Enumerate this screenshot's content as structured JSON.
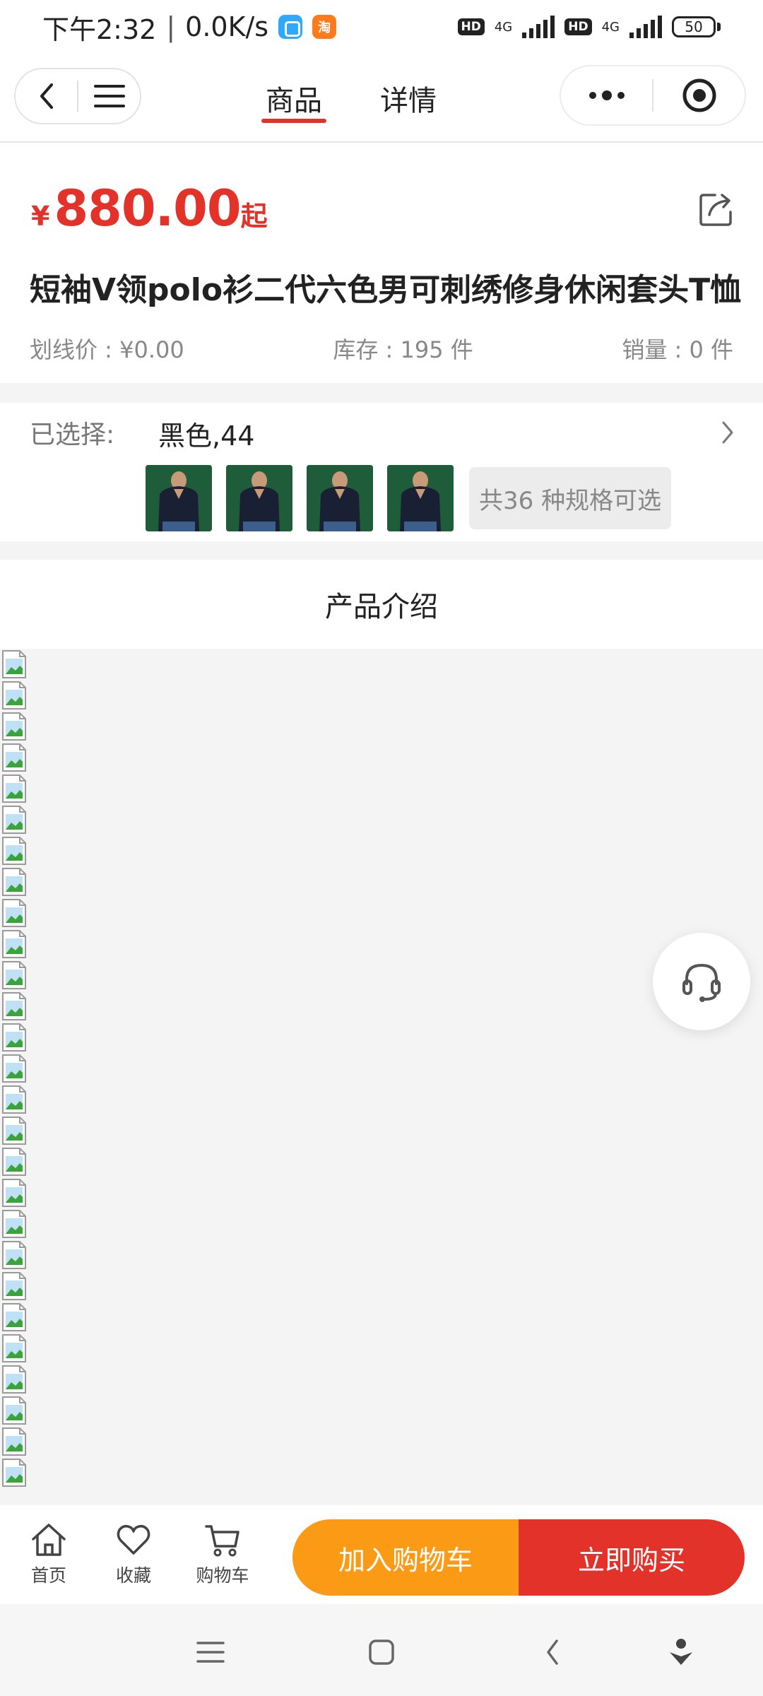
{
  "status_bar": {
    "time": "下午2:32",
    "speed": "0.0K/s",
    "app2_text": "淘",
    "hd1": "HD",
    "net1": "4G",
    "hd2": "HD",
    "net2": "4G",
    "battery": "50"
  },
  "nav": {
    "tabs": [
      {
        "label": "商品",
        "active": true
      },
      {
        "label": "详情",
        "active": false
      }
    ]
  },
  "product": {
    "currency": "¥",
    "price": "880.00",
    "price_suffix": "起",
    "title": "短袖V领polo衫二代六色男可刺绣修身休闲套头T恤",
    "list_price": "划线价 : ¥0.00",
    "stock": "库存 : 195 件",
    "sales": "销量 : 0 件"
  },
  "selection": {
    "label": "已选择:",
    "value": "黑色,44",
    "spec_count": "共36 种规格可选",
    "thumbnail_count": 4
  },
  "intro": {
    "title": "产品介绍",
    "broken_image_count": 27
  },
  "bottom": {
    "home": "首页",
    "favorite": "收藏",
    "cart": "购物车",
    "add_to_cart": "加入购物车",
    "buy_now": "立即购买"
  },
  "colors": {
    "accent_red": "#e2322a",
    "cart_orange": "#fb9a14",
    "background_gray": "#f4f4f4"
  },
  "icons": [
    "back-icon",
    "menu-icon",
    "more-icon",
    "record-icon",
    "share-icon",
    "chevron-right-icon",
    "headset-icon",
    "home-icon",
    "heart-icon",
    "cart-icon",
    "recents-icon",
    "home-square-icon",
    "back-triangle-icon",
    "assistant-icon"
  ]
}
